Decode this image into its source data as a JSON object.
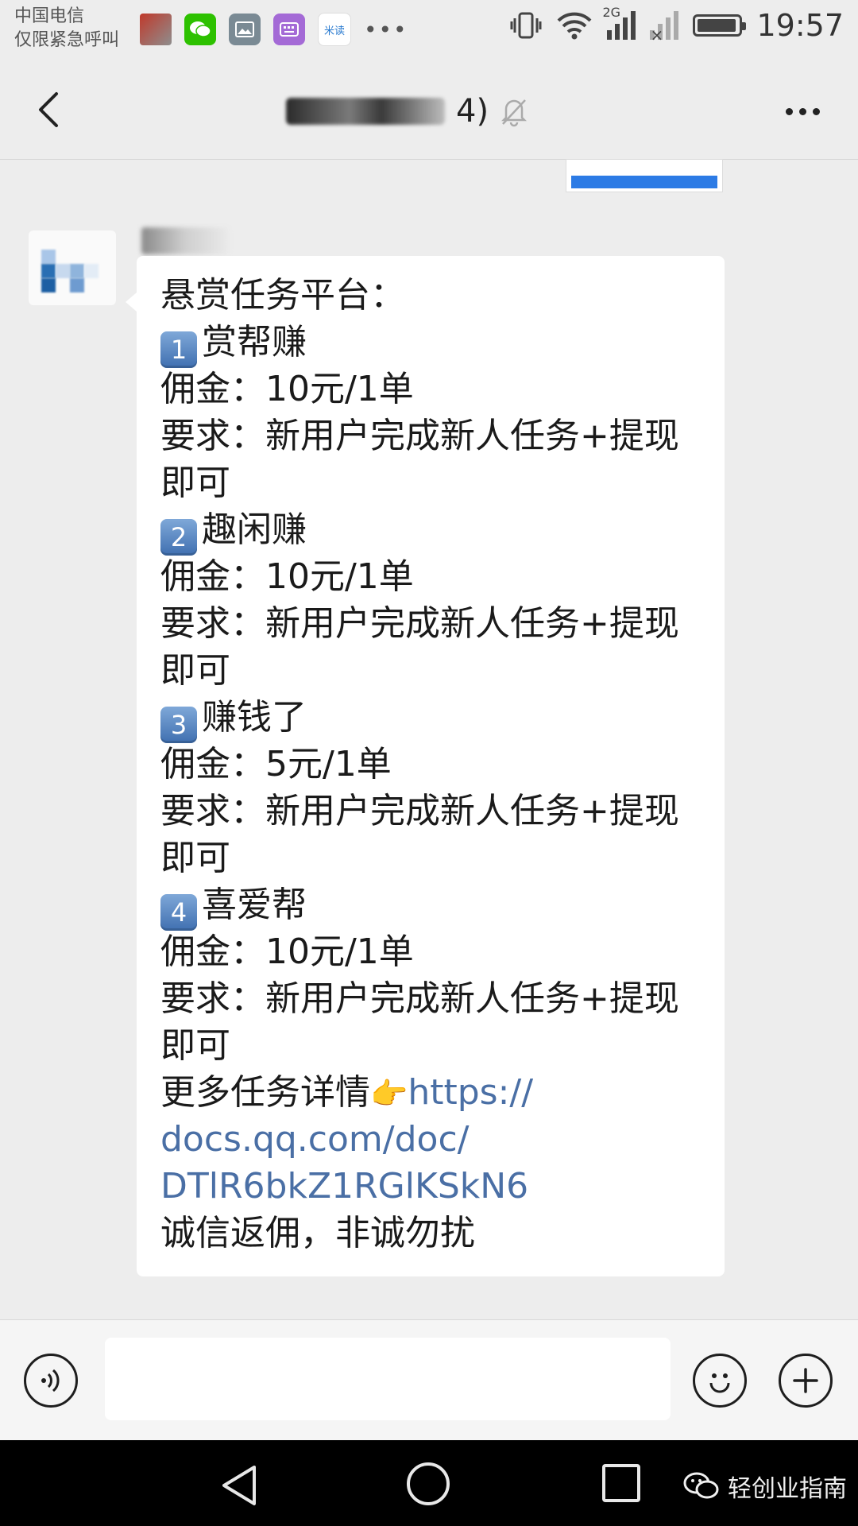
{
  "status_bar": {
    "carrier_line1": "中国电信",
    "carrier_line2": "仅限紧急呼叫",
    "network": "2G",
    "time": "19:57",
    "notif_mi_label": "米读"
  },
  "header": {
    "title_count": "4)"
  },
  "message": {
    "lines": [
      "悬赏任务平台：",
      "赏帮赚",
      "佣金：10元/1单",
      "要求：新用户完成新人任务+提现",
      "即可",
      "趣闲赚",
      "佣金：10元/1单",
      "要求：新用户完成新人任务+提现",
      "即可",
      "赚钱了",
      "佣金：5元/1单",
      "要求：新用户完成新人任务+提现",
      "即可",
      "喜爱帮",
      "佣金：10元/1单",
      "要求：新用户完成新人任务+提现",
      "即可",
      "更多任务详情",
      "https://",
      "docs.qq.com/doc/",
      "DTlR6bkZ1RGlKSkN6",
      "诚信返佣，非诚勿扰"
    ],
    "keycaps": [
      "1",
      "2",
      "3",
      "4"
    ],
    "pointing_emoji": "👉"
  },
  "watermark": {
    "text": "轻创业指南"
  },
  "colors": {
    "background": "#ededed",
    "bubble": "#ffffff",
    "link": "#4a6fa5",
    "nav": "#000000"
  }
}
